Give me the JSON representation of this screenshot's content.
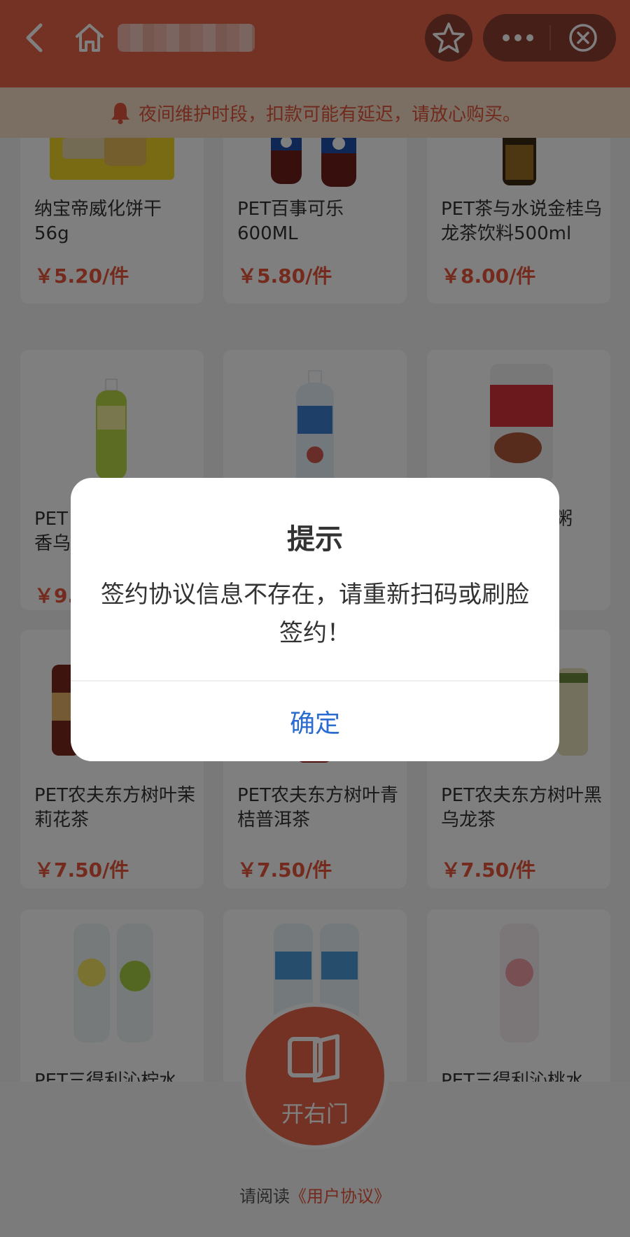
{
  "colors": {
    "brand": "#e8654a",
    "price": "#e8563a",
    "link": "#2b6cd0",
    "notice_bg": "#f7dcc6"
  },
  "header": {
    "back_icon": "chevron-left-icon",
    "home_icon": "home-icon",
    "star_icon": "star-icon",
    "more_icon": "more-dots-icon",
    "close_icon": "close-circle-icon"
  },
  "notice": {
    "icon": "bell-icon",
    "text": "夜间维护时段，扣款可能有延迟，请放心购买。"
  },
  "products": [
    {
      "name": "纳宝帝威化饼干56g",
      "price": "￥5.20/件"
    },
    {
      "name": "PET百事可乐600ML",
      "price": "￥5.80/件"
    },
    {
      "name": "PET茶与水说金桂乌龙茶饮料500ml",
      "price": "￥8.00/件"
    },
    {
      "name": "PET",
      "name2": "香乌",
      "price": "￥9."
    },
    {
      "name": "",
      "price": ""
    },
    {
      "name": "宝粥",
      "price": ""
    },
    {
      "name": "PET农夫东方树叶茉莉花茶",
      "price": "￥7.50/件"
    },
    {
      "name": "PET农夫东方树叶青桔普洱茶",
      "price": "￥7.50/件"
    },
    {
      "name": "PET农夫东方树叶黑乌龙茶",
      "price": "￥7.50/件"
    },
    {
      "name": "PET三得利沁柠水",
      "price": ""
    },
    {
      "name": "",
      "price": ""
    },
    {
      "name": "PET三得利沁桃水",
      "price": ""
    }
  ],
  "bottom": {
    "open_door_label": "开右门",
    "agreement_prefix": "请阅读",
    "agreement_link": "《用户协议》"
  },
  "dialog": {
    "title": "提示",
    "message": "签约协议信息不存在，请重新扫码或刷脸签约！",
    "ok_label": "确定"
  }
}
